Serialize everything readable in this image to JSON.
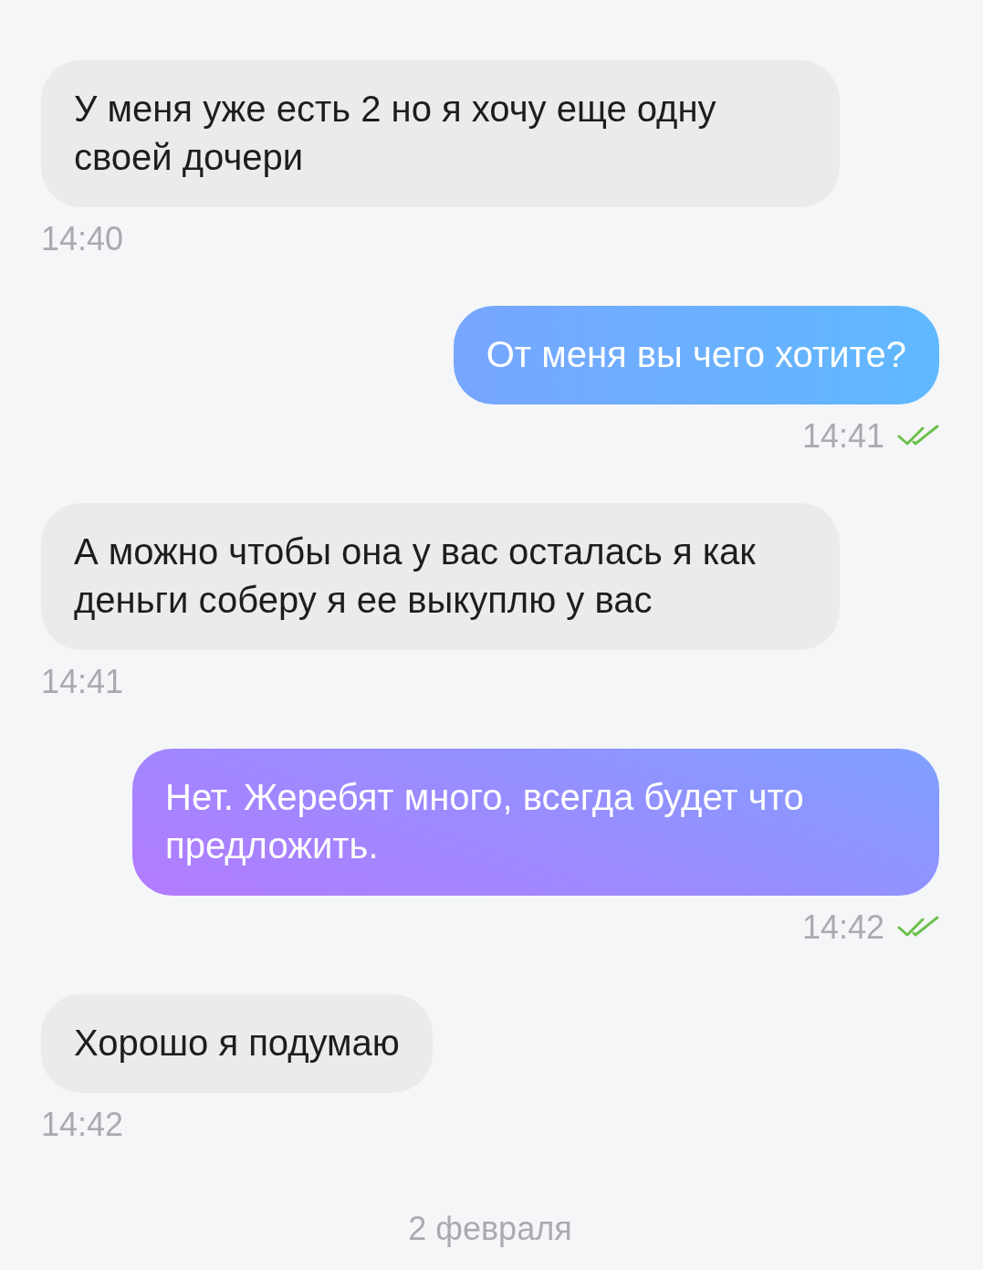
{
  "messages": [
    {
      "kind": "incoming",
      "text": "У меня уже есть 2 но я хочу еще одну своей дочери",
      "time": "14:40"
    },
    {
      "kind": "outgoing",
      "text": "От меня вы чего хотите?",
      "time": "14:41",
      "read": true
    },
    {
      "kind": "incoming",
      "text": "А можно чтобы она у вас осталась я как деньги соберу я ее выкуплю у вас",
      "time": "14:41"
    },
    {
      "kind": "outgoing",
      "text": "Нет. Жеребят много, всегда будет что предложить.",
      "time": "14:42",
      "read": true
    },
    {
      "kind": "incoming",
      "text": "Хорошо я подумаю",
      "time": "14:42"
    }
  ],
  "date_separator": "2 февраля"
}
